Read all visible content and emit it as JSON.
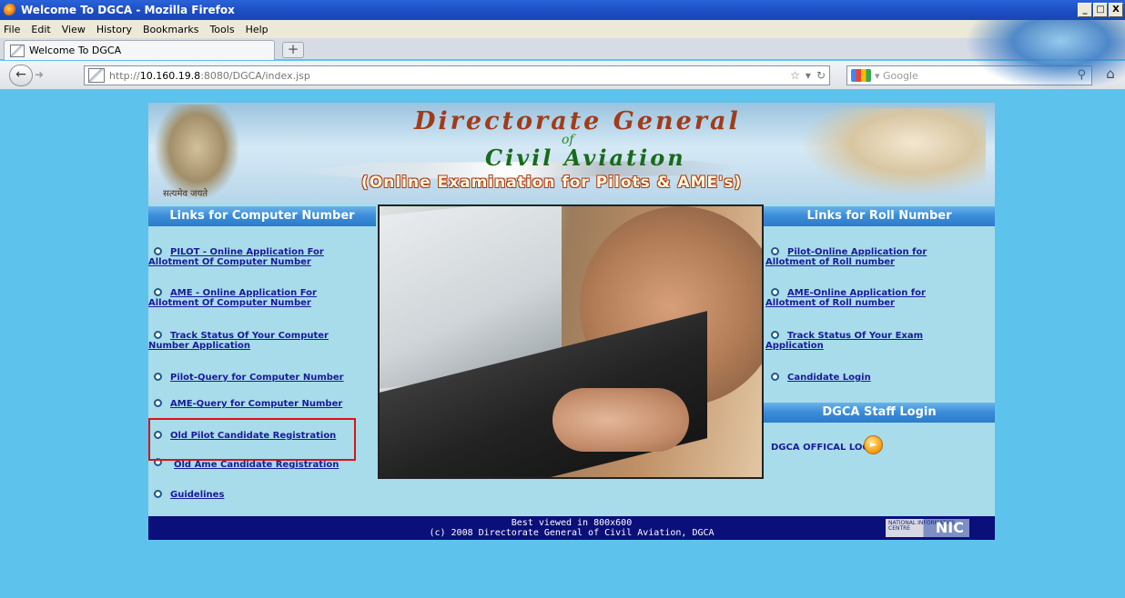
{
  "window": {
    "title": "Welcome To DGCA - Mozilla Firefox",
    "controls": [
      "_",
      "□",
      "X"
    ]
  },
  "menu": [
    "File",
    "Edit",
    "View",
    "History",
    "Bookmarks",
    "Tools",
    "Help"
  ],
  "tab": {
    "label": "Welcome To DGCA",
    "new_tab": "+"
  },
  "nav": {
    "url_prefix": "http://",
    "url_host": "10.160.19.8",
    "url_path": ":8080/DGCA/index.jsp",
    "search_placeholder": "Google"
  },
  "banner": {
    "line1": "Directorate General",
    "line2": "of",
    "line3": "Civil Aviation",
    "line4": "(Online Examination for Pilots & AME's)",
    "emblem_caption": "सत्यमेव जयते"
  },
  "left_column": {
    "heading": "Links for Computer Number",
    "links": [
      {
        "line1": "PILOT - Online Application For",
        "line2": "Allotment Of Computer Number"
      },
      {
        "line1": "AME - Online Application For",
        "line2": "Allotment Of Computer Number"
      },
      {
        "line1": "Track Status Of Your Computer",
        "line2": "Number Application"
      },
      {
        "line1": "Pilot-Query for Computer Number",
        "line2": ""
      },
      {
        "line1": "AME-Query for Computer Number",
        "line2": ""
      },
      {
        "line1": "Old Pilot Candidate Registration",
        "line2": ""
      },
      {
        "line1": "Old Ame Candidate Registration",
        "line2": ""
      },
      {
        "line1": "Guidelines",
        "line2": ""
      }
    ]
  },
  "right_column": {
    "heading": "Links for Roll Number",
    "links": [
      {
        "line1": "Pilot-Online Application for",
        "line2": "Allotment of Roll number"
      },
      {
        "line1": "AME-Online Application for",
        "line2": "Allotment of Roll number"
      },
      {
        "line1": "Track Status Of Your Exam",
        "line2": "Application"
      },
      {
        "line1": "Candidate Login",
        "line2": ""
      }
    ],
    "staff_heading": "DGCA Staff Login",
    "official_login": "DGCA OFFICAL LOGIN"
  },
  "footer": {
    "line1": "Best viewed in 800x600",
    "line2": "(c) 2008 Directorate General of Civil Aviation, DGCA",
    "nic_small": "NATIONAL INFORMATICS CENTRE",
    "nic_big": "NIC"
  }
}
